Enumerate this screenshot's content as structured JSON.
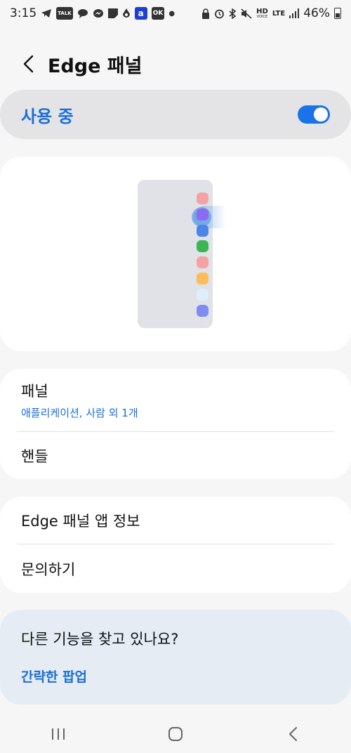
{
  "status_bar": {
    "time": "3:15",
    "left_icons": [
      "telegram-icon",
      "kakaotalk-icon",
      "chat-bubble-icon",
      "messenger-icon",
      "note-icon",
      "location-drop-icon",
      "app-a-icon",
      "okcashbag-icon",
      "dot-icon"
    ],
    "talk_badge": "TALK",
    "a_badge": "a",
    "ok_badge": "OK",
    "right_icons": [
      "lock-icon",
      "alarm-icon",
      "bluetooth-icon",
      "mute-icon"
    ],
    "hd_label": "HD",
    "voice_label": "VOICE",
    "lte_label": "LTE",
    "battery_percent": "46%"
  },
  "header": {
    "back_icon": "chevron-left-icon",
    "title": "Edge 패널"
  },
  "master_switch": {
    "label": "사용 중",
    "enabled": true,
    "color": "#1a73e8"
  },
  "preview": {
    "app_colors": [
      "#f3a3a3",
      "#8b6cf0",
      "#4a86e8",
      "#3cb655",
      "#f3a3a3",
      "#fbbd5c",
      "#dfeefb",
      "#7f8cf0"
    ]
  },
  "group1": {
    "panels": {
      "title": "패널",
      "subtitle": "애플리케이션, 사람 외 1개"
    },
    "handle": {
      "title": "핸들"
    }
  },
  "group2": {
    "about": {
      "title": "Edge 패널 앱 정보"
    },
    "contact": {
      "title": "문의하기"
    }
  },
  "suggestion": {
    "title": "다른 기능을 찾고 있나요?",
    "link": "간략한 팝업"
  },
  "nav_bar": {
    "icons": [
      "recent-apps-icon",
      "home-icon",
      "back-icon"
    ]
  },
  "colors": {
    "accent": "#1a6fd6",
    "background": "#f6f6f6"
  }
}
